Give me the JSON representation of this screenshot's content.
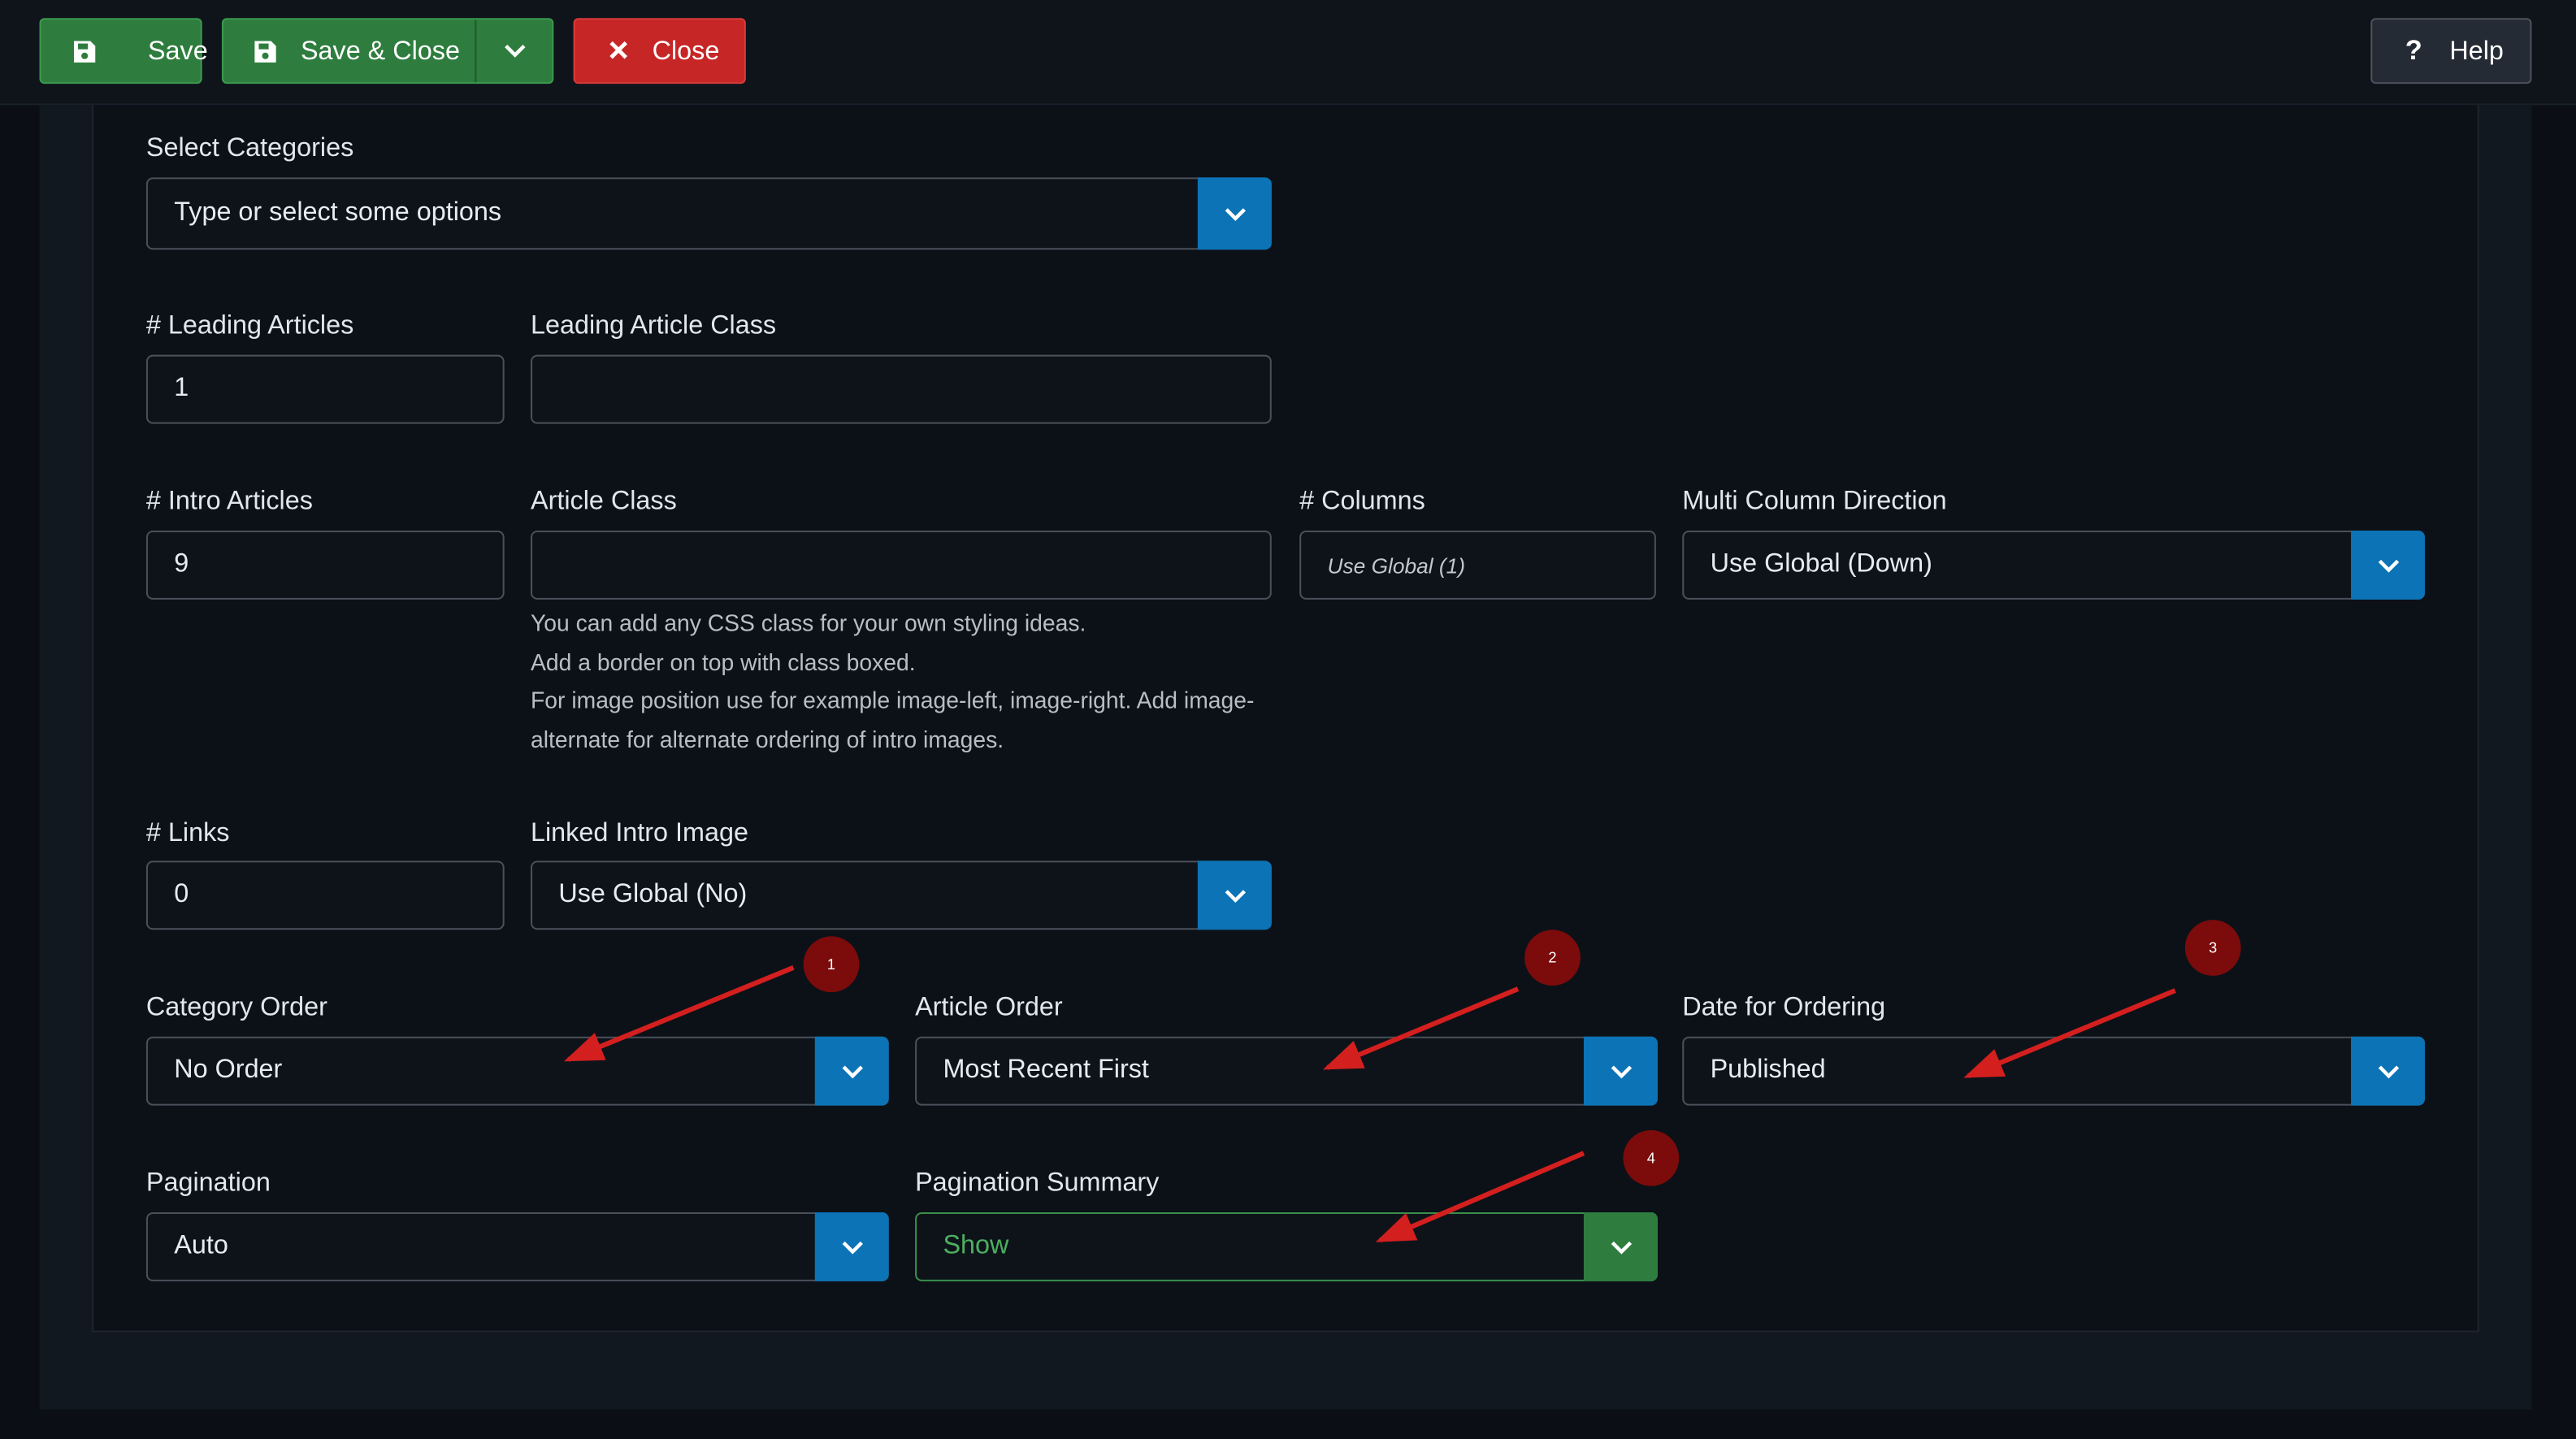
{
  "toolbar": {
    "save_label": "Save",
    "save_close_label": "Save & Close",
    "close_label": "Close",
    "help_label": "Help",
    "help_glyph": "?"
  },
  "form": {
    "categories": {
      "label": "Select Categories",
      "placeholder": "Type or select some options"
    },
    "leading_articles": {
      "label": "# Leading Articles",
      "value": "1"
    },
    "leading_article_class": {
      "label": "Leading Article Class",
      "value": ""
    },
    "intro_articles": {
      "label": "# Intro Articles",
      "value": "9"
    },
    "article_class": {
      "label": "Article Class",
      "value": "",
      "help": [
        "You can add any CSS class for your own styling ideas.",
        "Add a border on top with class boxed.",
        "For image position use for example image-left, image-right. Add image-",
        "alternate for alternate ordering of intro images."
      ]
    },
    "columns": {
      "label": "# Columns",
      "placeholder": "Use Global (1)"
    },
    "multi_column_direction": {
      "label": "Multi Column Direction",
      "value": "Use Global (Down)"
    },
    "links": {
      "label": "# Links",
      "value": "0"
    },
    "linked_intro_image": {
      "label": "Linked Intro Image",
      "value": "Use Global (No)"
    },
    "category_order": {
      "label": "Category Order",
      "value": "No Order"
    },
    "article_order": {
      "label": "Article Order",
      "value": "Most Recent First"
    },
    "date_for_ordering": {
      "label": "Date for Ordering",
      "value": "Published"
    },
    "pagination": {
      "label": "Pagination",
      "value": "Auto"
    },
    "pagination_summary": {
      "label": "Pagination Summary",
      "value": "Show"
    }
  },
  "annotations": [
    "1",
    "2",
    "3",
    "4"
  ],
  "colors": {
    "save_green": "#2e7d3e",
    "close_red": "#c72626",
    "select_blue": "#0b73b6",
    "annotation_red": "#d41f1f",
    "badge_red": "#7c0b0b"
  },
  "icons": {
    "save": "floppy-disk-icon",
    "close": "x-icon",
    "dropdown": "chevron-down-icon",
    "help": "question-icon"
  }
}
